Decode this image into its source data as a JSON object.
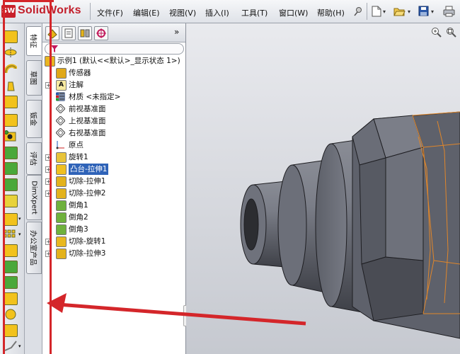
{
  "app": {
    "brand_badge": "SW",
    "title": "SolidWorks"
  },
  "menu": [
    "文件(F)",
    "编辑(E)",
    "视图(V)",
    "插入(I)",
    "工具(T)",
    "窗口(W)",
    "帮助(H)"
  ],
  "toolbar": [
    "pin-icon",
    "new-document-icon",
    "open-folder-icon",
    "save-icon",
    "print-icon"
  ],
  "vtabs": [
    {
      "label": "特征",
      "active": true
    },
    {
      "label": "草图",
      "active": false
    },
    {
      "label": "钣金",
      "active": false
    },
    {
      "label": "评估",
      "active": false
    },
    {
      "label": "DimXpert",
      "active": false
    },
    {
      "label": "办公室产品",
      "active": false
    }
  ],
  "panel": {
    "tabs": [
      "feature-manager-icon",
      "property-manager-icon",
      "configuration-manager-icon",
      "dimxpert-manager-icon"
    ],
    "expand_glyph": "»"
  },
  "tree": [
    {
      "label": "示例1  (默认<<默认>_显示状态 1>)",
      "icon": "part-icon",
      "color": "#e9b521",
      "expander": false,
      "selected": false
    },
    {
      "label": "传感器",
      "icon": "sensor-icon",
      "color": "#e0a818",
      "expander": false,
      "selected": false
    },
    {
      "label": "注解",
      "icon": "annotation-icon",
      "color": "#f7eaa0",
      "expander": true,
      "selected": false
    },
    {
      "label": "材质 <未指定>",
      "icon": "material-icon",
      "color": "#7a8aa8",
      "expander": false,
      "selected": false
    },
    {
      "label": "前视基准面",
      "icon": "plane-icon",
      "color": "#ffffff",
      "expander": false,
      "selected": false
    },
    {
      "label": "上视基准面",
      "icon": "plane-icon",
      "color": "#ffffff",
      "expander": false,
      "selected": false
    },
    {
      "label": "右视基准面",
      "icon": "plane-icon",
      "color": "#ffffff",
      "expander": false,
      "selected": false
    },
    {
      "label": "原点",
      "icon": "origin-icon",
      "color": "#ffffff",
      "expander": false,
      "selected": false
    },
    {
      "label": "旋转1",
      "icon": "revolve-icon",
      "color": "#e8c43a",
      "expander": true,
      "selected": false
    },
    {
      "label": "凸台-拉伸1",
      "icon": "boss-extrude-icon",
      "color": "#f0c020",
      "expander": true,
      "selected": true
    },
    {
      "label": "切除-拉伸1",
      "icon": "cut-extrude-icon",
      "color": "#e3b21c",
      "expander": true,
      "selected": false
    },
    {
      "label": "切除-拉伸2",
      "icon": "cut-extrude-icon",
      "color": "#e3b21c",
      "expander": true,
      "selected": false
    },
    {
      "label": "倒角1",
      "icon": "chamfer-icon",
      "color": "#6fb13d",
      "expander": false,
      "selected": false
    },
    {
      "label": "倒角2",
      "icon": "chamfer-icon",
      "color": "#6fb13d",
      "expander": false,
      "selected": false
    },
    {
      "label": "倒角3",
      "icon": "chamfer-icon",
      "color": "#6fb13d",
      "expander": false,
      "selected": false
    },
    {
      "label": "切除-旋转1",
      "icon": "cut-revolve-icon",
      "color": "#e8b820",
      "expander": true,
      "selected": false
    },
    {
      "label": "切除-拉伸3",
      "icon": "cut-extrude-icon",
      "color": "#e3b21c",
      "expander": true,
      "selected": false
    }
  ],
  "viewport": {
    "tools": [
      "zoom-to-fit-icon",
      "zoom-area-icon"
    ]
  },
  "colors": {
    "annotation_red": "#d4262a",
    "selection_blue": "#2f63b8",
    "model_gray": "#6b6e78",
    "highlight_orange": "#e0862a"
  }
}
